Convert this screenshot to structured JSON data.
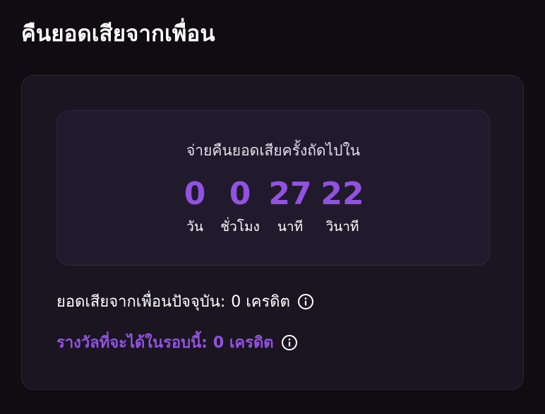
{
  "header": {
    "title": "คืนยอดเสียจากเพื่อน"
  },
  "countdown": {
    "caption": "จ่ายคืนยอดเสียครั้งถัดไปใน",
    "units": [
      {
        "value": "0",
        "label": "วัน"
      },
      {
        "value": "0",
        "label": "ชั่วโมง"
      },
      {
        "value": "27",
        "label": "นาที"
      },
      {
        "value": "22",
        "label": "วินาที"
      }
    ]
  },
  "current_loss": {
    "label": "ยอดเสียจากเพื่อนปัจจุบัน:",
    "value": "0 เครดิต",
    "icon": "info-icon"
  },
  "reward": {
    "label": "รางวัลที่จะได้ในรอบนี้:",
    "value": "0 เครดิต",
    "icon": "info-icon"
  },
  "colors": {
    "background": "#100c12",
    "card": "#1a1520",
    "countdown_box": "#211a2c",
    "accent": "#9152e0",
    "text": "#ffffff"
  }
}
